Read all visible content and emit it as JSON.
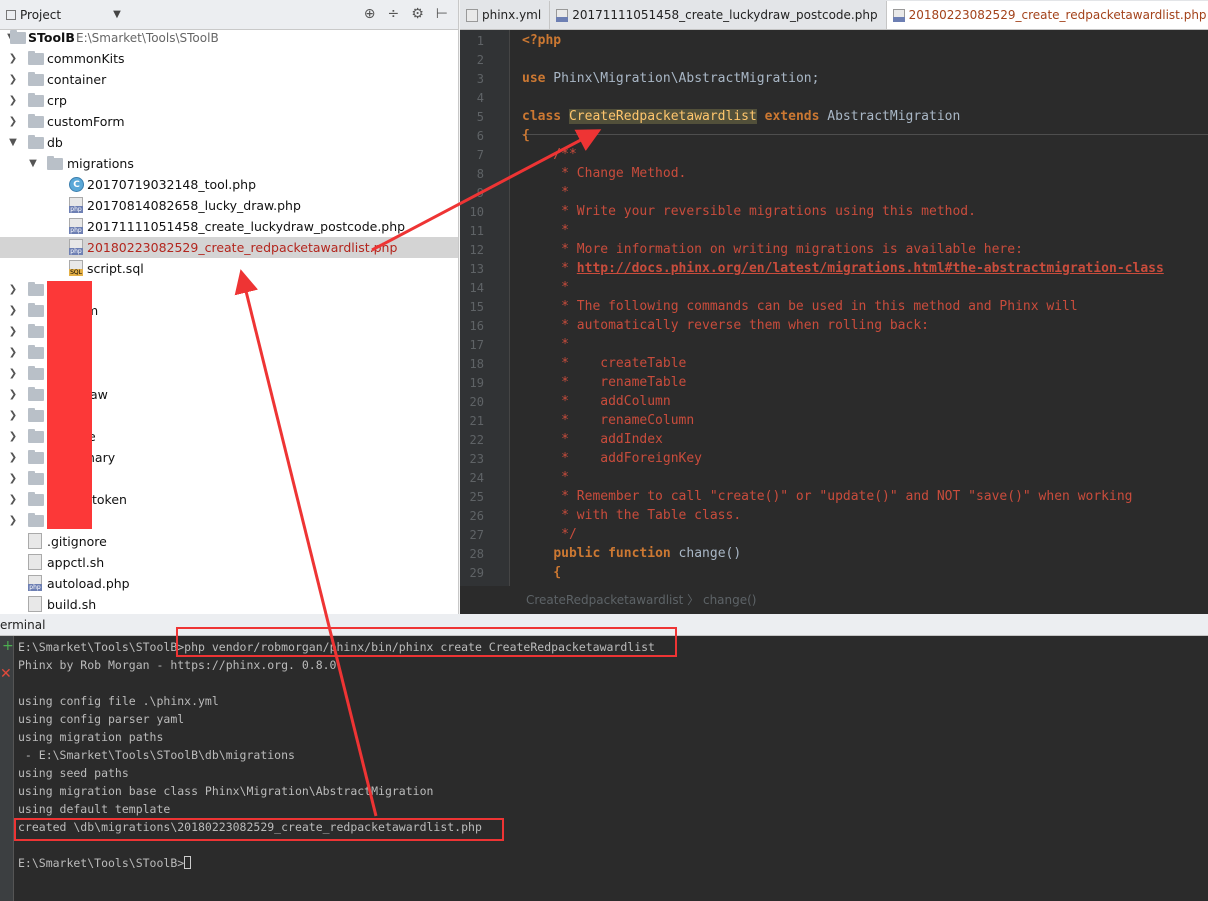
{
  "project": {
    "title": "Project",
    "dropdown": "▼",
    "tools": [
      "⊕",
      "÷",
      "⚙",
      "⊢"
    ],
    "root_name": "SToolB",
    "root_path": "E:\\Smarket\\Tools\\SToolB",
    "tree": [
      {
        "label": "commonKits"
      },
      {
        "label": "container"
      },
      {
        "label": "crp"
      },
      {
        "label": "customForm"
      },
      {
        "label": "db"
      },
      {
        "label": "migrations"
      },
      {
        "label": "20170719032148_tool.php"
      },
      {
        "label": "20170814082658_lucky_draw.php"
      },
      {
        "label": "20171111051458_create_luckydraw_postcode.php"
      },
      {
        "label": "20180223082529_create_redpacketawardlist.php"
      },
      {
        "label": "script.sql"
      },
      {
        "label": "m"
      },
      {
        "label": "aw"
      },
      {
        "label": "e"
      },
      {
        "label": "nary"
      },
      {
        "label": "token"
      },
      {
        "label": ".gitignore"
      },
      {
        "label": "appctl.sh"
      },
      {
        "label": "autoload.php"
      },
      {
        "label": "build.sh"
      }
    ],
    "class_icon_letter": "C"
  },
  "editor": {
    "tabs": [
      {
        "label": "phinx.yml"
      },
      {
        "label": "20171111051458_create_luckydraw_postcode.php"
      },
      {
        "label": "20180223082529_create_redpacketawardlist.php"
      }
    ],
    "line_numbers": [
      "1",
      "2",
      "3",
      "4",
      "5",
      "6",
      "7",
      "8",
      "9",
      "10",
      "11",
      "12",
      "13",
      "14",
      "15",
      "16",
      "17",
      "18",
      "19",
      "20",
      "21",
      "22",
      "23",
      "24",
      "25",
      "26",
      "27",
      "28",
      "29"
    ],
    "code": {
      "l1": "<?php",
      "l3_kw": "use",
      "l3_ns": " Phinx\\Migration\\AbstractMigration;",
      "l5_kw": "class",
      "l5_cls": "CreateRedpacketawardlist",
      "l5_kw2": "extends",
      "l5_parent": "AbstractMigration",
      "l6": "{",
      "l7": "    /**",
      "l8": "     * Change Method.",
      "l9": "     *",
      "l10": "     * Write your reversible migrations using this method.",
      "l11": "     *",
      "l12": "     * More information on writing migrations is available here:",
      "l13_prefix": "     * ",
      "l13_link": "http://docs.phinx.org/en/latest/migrations.html#the-abstractmigration-class",
      "l14": "     *",
      "l15": "     * The following commands can be used in this method and Phinx will",
      "l16": "     * automatically reverse them when rolling back:",
      "l17": "     *",
      "l18": "     *    createTable",
      "l19": "     *    renameTable",
      "l20": "     *    addColumn",
      "l21": "     *    renameColumn",
      "l22": "     *    addIndex",
      "l23": "     *    addForeignKey",
      "l24": "     *",
      "l25": "     * Remember to call \"create()\" or \"update()\" and NOT \"save()\" when working",
      "l26": "     * with the Table class.",
      "l27": "     */",
      "l28_kw1": "public",
      "l28_kw2": "function",
      "l28_rest": " change()",
      "l29": "    {"
    },
    "breadcrumb": "CreateRedpacketawardlist  〉 change()"
  },
  "terminal": {
    "header": "erminal",
    "prompt": "E:\\Smarket\\Tools\\SToolB>",
    "command": "php vendor/robmorgan/phinx/bin/phinx create CreateRedpacketawardlist",
    "lines": [
      "Phinx by Rob Morgan - https://phinx.org. 0.8.0",
      "",
      "using config file .\\phinx.yml",
      "using config parser yaml",
      "using migration paths",
      " - E:\\Smarket\\Tools\\SToolB\\db\\migrations",
      "using seed paths",
      "using migration base class Phinx\\Migration\\AbstractMigration",
      "using default template",
      "created \\db\\migrations\\20180223082529_create_redpacketawardlist.php",
      "",
      "E:\\Smarket\\Tools\\SToolB>"
    ]
  },
  "colors": {
    "annotation": "#ee3434",
    "editor_bg": "#2b2b2b",
    "keyword": "#cc7832",
    "comment": "#c94c3c"
  }
}
